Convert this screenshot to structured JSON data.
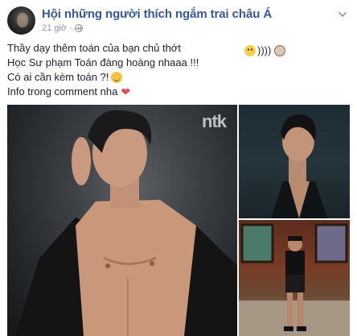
{
  "header": {
    "group_name": "Hội những người thích ngắm trai châu Á",
    "timestamp": "21 giờ",
    "privacy_icon": "globe-icon",
    "menu_icon": "chevron-down-icon"
  },
  "post": {
    "lines": [
      "Thầy dạy thêm toán của bạn chủ thớt",
      "Học Sư phạm Toán đàng hoàng nhaaa !!!",
      "Có ai cần kèm toán ?!",
      "Info trong comment nha"
    ],
    "emoji_trail_text": "))))"
  },
  "photos": {
    "main_watermark": "ntk"
  },
  "colors": {
    "link": "#365899",
    "meta": "#90949c",
    "text": "#1d2129",
    "heart": "#e9485d"
  }
}
